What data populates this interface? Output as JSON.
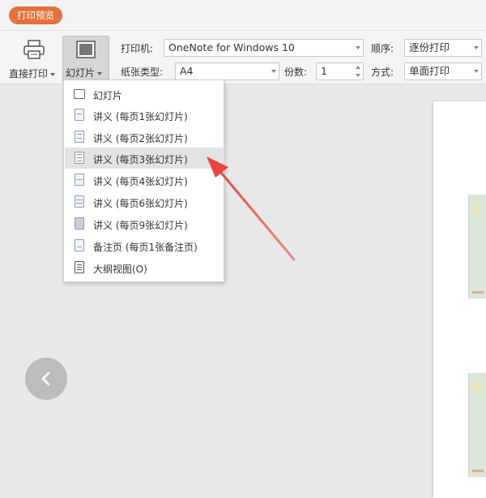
{
  "titlebar": {
    "tab_label": "打印预览"
  },
  "toolbar": {
    "direct_print": "直接打印",
    "slides_button": "幻灯片",
    "printer_label": "打印机:",
    "printer_value": "OneNote for Windows 10",
    "paper_label": "纸张类型:",
    "paper_value": "A4",
    "copies_label": "份数:",
    "copies_value": "1",
    "order_label": "顺序:",
    "order_value": "逐份打印",
    "mode_label": "方式:",
    "mode_value": "单面打印"
  },
  "menu": {
    "items": [
      {
        "label": "幻灯片",
        "icon": "slide-icon"
      },
      {
        "label": "讲义 (每页1张幻灯片)",
        "icon": "handout-1-icon"
      },
      {
        "label": "讲义 (每页2张幻灯片)",
        "icon": "handout-2-icon"
      },
      {
        "label": "讲义 (每页3张幻灯片)",
        "icon": "handout-3-icon"
      },
      {
        "label": "讲义 (每页4张幻灯片)",
        "icon": "handout-4-icon"
      },
      {
        "label": "讲义 (每页6张幻灯片)",
        "icon": "handout-6-icon"
      },
      {
        "label": "讲义 (每页9张幻灯片)",
        "icon": "handout-9-icon"
      },
      {
        "label": "备注页 (每页1张备注页)",
        "icon": "notes-page-icon"
      },
      {
        "label": "大纲视图(O)",
        "icon": "outline-icon"
      }
    ],
    "highlighted_index": 3
  },
  "colors": {
    "accent": "#e5703a",
    "annotation_arrow": "#e8453c"
  }
}
